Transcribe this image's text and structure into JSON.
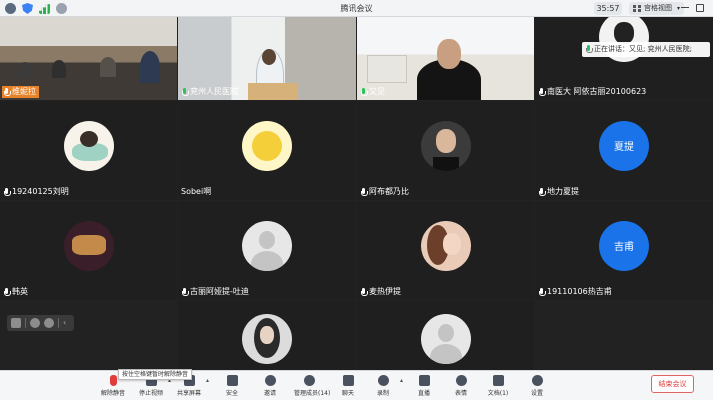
{
  "window": {
    "title": "腾讯会议",
    "timer": "35:57",
    "view_mode": "宫格视图"
  },
  "speaking_notice": "正在讲话：又见; 兖州人民医院;",
  "tiles": [
    {
      "name": "维妮拉"
    },
    {
      "name": "兖州人民医院"
    },
    {
      "name": "又见"
    },
    {
      "name": "南医大 阿依古丽20100623"
    },
    {
      "name": "19240125刘明"
    },
    {
      "name": "Sobei啊"
    },
    {
      "name": "阿布都乃比"
    },
    {
      "name": "地力夏提",
      "avatar_text": "夏提"
    },
    {
      "name": "韩英"
    },
    {
      "name": "古丽阿娅提-吐迪"
    },
    {
      "name": "麦热伊提"
    },
    {
      "name": "19110106热吉甫",
      "avatar_text": "吉甫"
    }
  ],
  "toolbar": {
    "tooltip": "按住空格键暂时解除静音",
    "items": [
      "解除静音",
      "停止视频",
      "共享屏幕",
      "安全",
      "邀请",
      "管理成员(14)",
      "聊天",
      "录制",
      "直播",
      "表情",
      "文档(1)",
      "设置"
    ],
    "end_meeting": "结束会议"
  },
  "colors": {
    "avatar_blue": "#1a73e8",
    "end_red": "#e03b3b",
    "speaking_green": "#2bc45a"
  }
}
